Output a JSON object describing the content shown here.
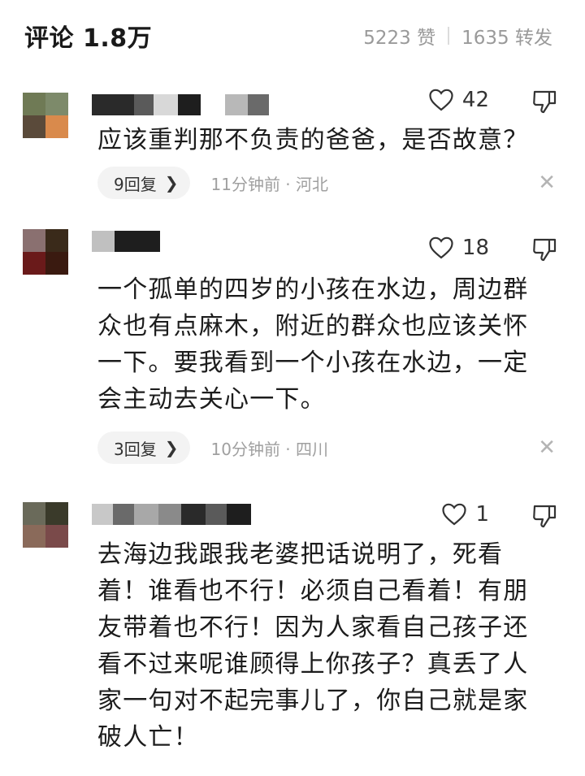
{
  "header": {
    "title": "评论 1.8万",
    "likes": "5223 赞",
    "shares": "1635 转发"
  },
  "comments": [
    {
      "likes": "42",
      "text": "应该重判那不负责的爸爸，是否故意？",
      "replies": "9回复",
      "time_location": "11分钟前 · 河北"
    },
    {
      "likes": "18",
      "text": "一个孤单的四岁的小孩在水边，周边群众也有点麻木，附近的群众也应该关怀一下。要我看到一个小孩在水边，一定会主动去关心一下。",
      "replies": "3回复",
      "time_location": "10分钟前 · 四川"
    },
    {
      "likes": "1",
      "text": "去海边我跟我老婆把话说明了，死看着！谁看也不行！必须自己看着！有朋友带着也不行！因为人家看自己孩子还看不过来呢谁顾得上你孩子？真丢了人家一句对不起完事儿了，你自己就是家破人亡！"
    }
  ],
  "icons": {
    "like": "heart-outline-icon",
    "dislike": "thumbs-down-icon",
    "chevron": "chevron-right-icon",
    "close": "close-icon"
  },
  "colors": {
    "secondary_text": "#9a9a9a",
    "pill_bg": "#f3f3f3"
  }
}
